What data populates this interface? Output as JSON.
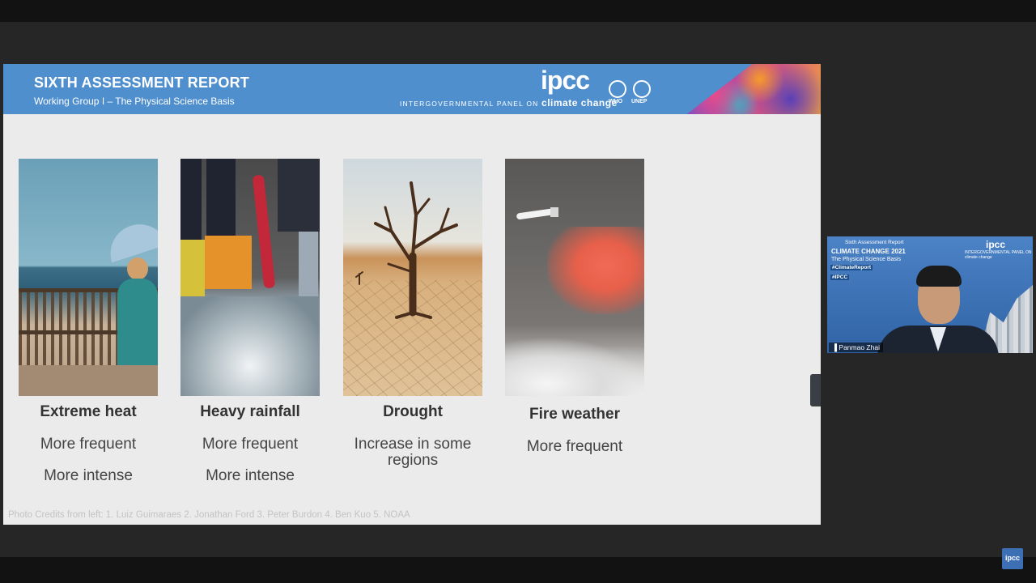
{
  "slide": {
    "title": "SIXTH ASSESSMENT REPORT",
    "subtitle": "Working Group I – The Physical Science Basis",
    "logo_text": "ipcc",
    "logo_line_small": "INTERGOVERNMENTAL PANEL ON",
    "logo_line_bold": "climate change",
    "org1": "WHO",
    "org2": "UNEP",
    "cards": [
      {
        "title": "Extreme heat",
        "lines": [
          "More frequent",
          "More intense"
        ]
      },
      {
        "title": "Heavy rainfall",
        "lines": [
          "More frequent",
          "More intense"
        ]
      },
      {
        "title": "Drought",
        "lines": [
          "Increase in some",
          "regions"
        ]
      },
      {
        "title": "Fire weather",
        "lines": [
          "More frequent"
        ]
      }
    ],
    "credits": "Photo Credits from left: 1. Luiz Guimaraes 2. Jonathan Ford 3. Peter Burdon 4. Ben Kuo 5. NOAA"
  },
  "speaker": {
    "report": "Sixth Assessment Report",
    "title": "CLIMATE CHANGE 2021",
    "basis": "The Physical Science Basis",
    "tag1": "#ClimateReport",
    "tag2": "#IPCC",
    "logo": "ipcc",
    "logo_sub": "INTERGOVERNMENTAL PANEL ON climate change",
    "name": "Panmao Zhai"
  },
  "corner_logo": "ipcc"
}
